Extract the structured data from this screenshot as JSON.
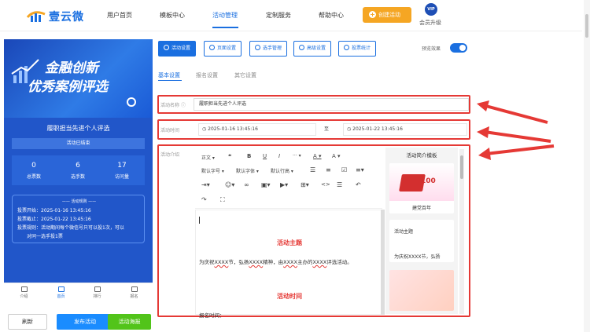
{
  "brand": {
    "name": "壹云微"
  },
  "nav": {
    "items": [
      "用户首页",
      "模板中心",
      "活动管理",
      "定制服务",
      "帮助中心"
    ],
    "active_index": 2,
    "create_label": "创建活动",
    "vip_badge": "VIP",
    "vip_label": "会员升级"
  },
  "preview": {
    "banner_line1": "金融创新",
    "banner_line2": "优秀案例评选",
    "activity_name": "履职担当先进个人评选",
    "status": "活动已结束",
    "stats": [
      {
        "value": "0",
        "label": "总票数"
      },
      {
        "value": "6",
        "label": "选手数"
      },
      {
        "value": "17",
        "label": "访问量"
      }
    ],
    "rules_title": "活动规则",
    "rules": [
      "投票开始：2025-01-16 13:45:16",
      "投票截止：2025-01-22 13:45:16",
      "投票规则：活动期间每个微信号只可以投1次，可以",
      "对同一选手投1票"
    ],
    "tabs": [
      "介绍",
      "首页",
      "排行",
      "报名"
    ],
    "active_tab": 1
  },
  "actions": {
    "refresh": "刷新",
    "publish": "发布活动",
    "poster": "活动海报"
  },
  "tool_tabs": [
    "活动设置",
    "页面设置",
    "选手管理",
    "高级设置",
    "投票统计"
  ],
  "preview_toggle": {
    "label": "预览效果",
    "on": true
  },
  "sub_tabs": [
    "基本设置",
    "报名设置",
    "其它设置"
  ],
  "form": {
    "name_label": "活动名称",
    "name_value": "履职担当先进个人评选",
    "time_label": "活动时间",
    "start": "2025-01-16 13:45:16",
    "to": "至",
    "end": "2025-01-22 13:45:16",
    "intro_label": "活动介绍"
  },
  "toolbar": {
    "row1": [
      "正文",
      "❝",
      "B",
      "U",
      "I",
      "···",
      "A",
      "A"
    ],
    "row2": [
      "默认字号",
      "默认字体",
      "默认行高"
    ]
  },
  "editor": {
    "heading1": "活动主题",
    "body1_prefix": "为庆祝",
    "body1_u1": "XXXX",
    "body1_mid1": "节，弘扬",
    "body1_u2": "XXXX",
    "body1_mid2": "精神，由",
    "body1_u3": "XXXX",
    "body1_mid3": "主办的",
    "body1_u4": "XXXX",
    "body1_suffix": "评选活动。",
    "heading2": "活动时间",
    "body2": "报名时间："
  },
  "templates": {
    "title": "活动简介模板",
    "card1_caption": "建党百年",
    "card2_title": "活动主题",
    "card2_text": "为庆祝XXXX节，弘扬"
  }
}
